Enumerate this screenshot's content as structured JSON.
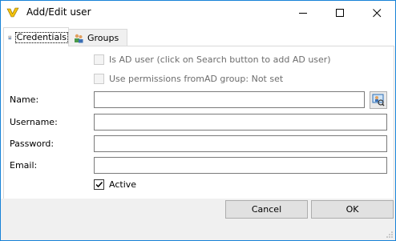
{
  "window": {
    "title": "Add/Edit user",
    "controls": [
      "minimize-icon",
      "maximize-icon",
      "close-icon"
    ],
    "accent": "#1883d7"
  },
  "tabs": [
    {
      "label": "Credentials",
      "icon": "user-credentials-icon",
      "active": true
    },
    {
      "label": "Groups",
      "icon": "group-icon",
      "active": false
    }
  ],
  "form": {
    "is_ad_user_label": "Is AD user (click on Search button to add AD user)",
    "use_permissions_label": "Use permissions fromAD group: Not set",
    "name_label": "Name:",
    "name_value": "",
    "username_label": "Username:",
    "username_value": "",
    "password_label": "Password:",
    "password_value": "",
    "email_label": "Email:",
    "email_value": "",
    "active_label": "Active",
    "active_checked": true
  },
  "buttons": {
    "cancel": "Cancel",
    "ok": "OK"
  }
}
